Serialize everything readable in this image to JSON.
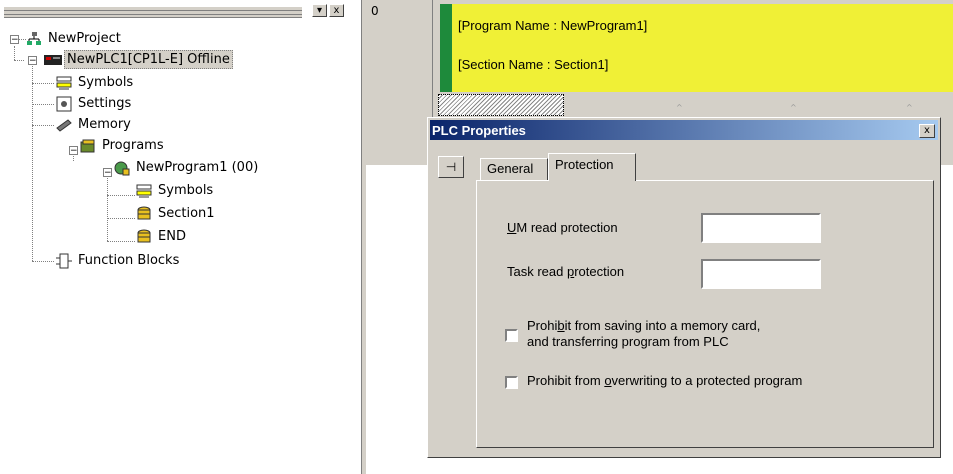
{
  "tree": {
    "pane_button_min": "▾",
    "pane_button_close": "x",
    "nodes": [
      {
        "label": "NewProject",
        "icon": "project-tree-icon"
      },
      {
        "label": "NewPLC1[CP1L-E] Offline",
        "icon": "plc-icon"
      },
      {
        "label": "Symbols",
        "icon": "symbols-icon"
      },
      {
        "label": "Settings",
        "icon": "settings-icon"
      },
      {
        "label": "Memory",
        "icon": "memory-icon"
      },
      {
        "label": "Programs",
        "icon": "programs-icon"
      },
      {
        "label": "NewProgram1 (00)",
        "icon": "program-icon"
      },
      {
        "label": "Symbols",
        "icon": "symbols-icon"
      },
      {
        "label": "Section1",
        "icon": "section-icon"
      },
      {
        "label": "END",
        "icon": "section-icon"
      },
      {
        "label": "Function Blocks",
        "icon": "function-blocks-icon"
      }
    ]
  },
  "ladder": {
    "rung_number": "0",
    "program_name": "[Program Name : NewProgram1]",
    "section_name": "[Section Name : Section1]"
  },
  "dialog": {
    "title": "PLC Properties",
    "close_glyph": "x",
    "pin_glyph": "⊣",
    "tabs": [
      {
        "label": "General",
        "active": false
      },
      {
        "label": "Protection",
        "active": true
      }
    ],
    "um_read_protection": {
      "pre": "",
      "accel": "U",
      "post": "M read protection",
      "value": ""
    },
    "task_read_protection": {
      "pre": "Task read ",
      "accel": "p",
      "post": "rotection",
      "value": ""
    },
    "prohibit_memory_card": {
      "line1_pre": "Prohi",
      "line1_accel": "b",
      "line1_post": "it from saving into a memory card,",
      "line2": "and transferring program from PLC",
      "checked": false
    },
    "prohibit_overwrite": {
      "pre": "Prohibit from ",
      "accel": "o",
      "post": "verwriting to a protected program",
      "checked": false
    }
  },
  "colors": {
    "title_bar_start": "#0a246a",
    "title_bar_end": "#a6caf0",
    "program_header_bg": "#f0f036",
    "rung_marker": "#1e8a3b",
    "window_face": "#d4d0c8"
  }
}
